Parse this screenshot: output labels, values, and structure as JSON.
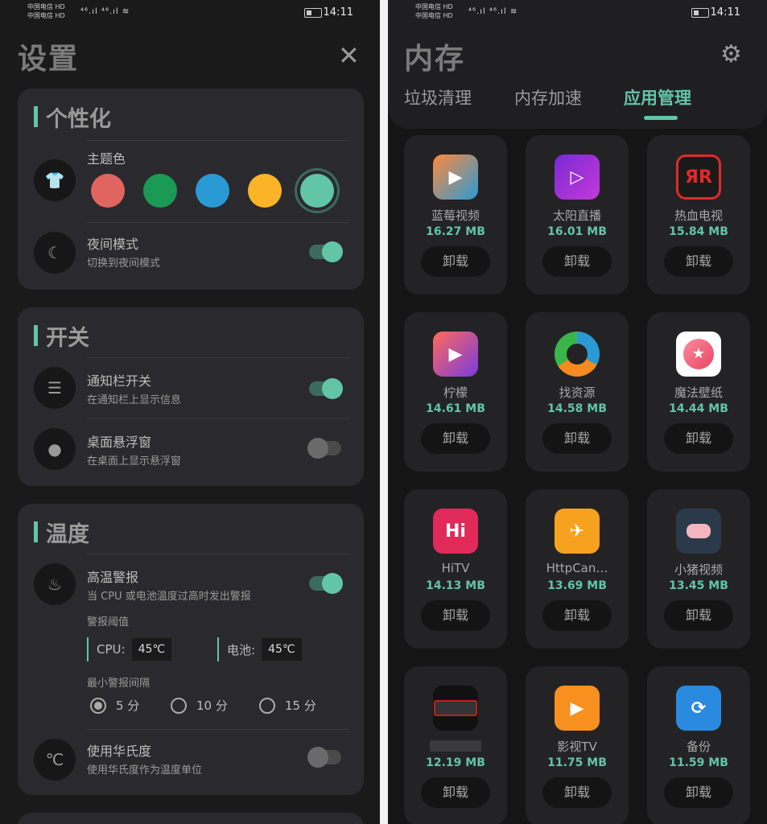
{
  "status": {
    "carrier1": "中国电信 HD",
    "carrier2": "中国电信 HD",
    "signal": "⁴⁶.ıl ⁴⁶.ıl ≋",
    "time": "14:11"
  },
  "settings": {
    "title": "设置",
    "close": "✕",
    "personalize": {
      "title": "个性化",
      "theme_label": "主题色",
      "colors": [
        "#e0645f",
        "#1a9a55",
        "#2a9ad4",
        "#fbb427",
        "#62c5a6"
      ],
      "selected_color": "#62c5a6",
      "night_title": "夜间模式",
      "night_sub": "切换到夜间模式",
      "night_on": true
    },
    "switches": {
      "title": "开关",
      "notify_title": "通知栏开关",
      "notify_sub": "在通知栏上显示信息",
      "notify_on": true,
      "float_title": "桌面悬浮窗",
      "float_sub": "在桌面上显示悬浮窗",
      "float_on": false
    },
    "temperature": {
      "title": "温度",
      "alert_title": "高温警报",
      "alert_sub": "当 CPU 或电池温度过高时发出警报",
      "alert_on": true,
      "threshold_label": "警报阈值",
      "cpu_label": "CPU:",
      "cpu_value": "45℃",
      "battery_label": "电池:",
      "battery_value": "45℃",
      "interval_label": "最小警报间隔",
      "intervals": [
        "5 分",
        "10 分",
        "15 分"
      ],
      "interval_selected": "5 分",
      "fahrenheit_title": "使用华氏度",
      "fahrenheit_sub": "使用华氏度作为温度单位",
      "fahrenheit_on": false
    }
  },
  "memory": {
    "title": "内存",
    "tabs": [
      "垃圾清理",
      "内存加速",
      "应用管理"
    ],
    "active_tab": "应用管理",
    "uninstall_label": "卸载",
    "apps": [
      {
        "name": "蓝莓视频",
        "size": "16.27 MB",
        "icon": "play-icon"
      },
      {
        "name": "太阳直播",
        "size": "16.01 MB",
        "icon": "play-icon"
      },
      {
        "name": "热血电视",
        "size": "15.84 MB",
        "icon": "r-icon"
      },
      {
        "name": "柠檬",
        "size": "14.61 MB",
        "icon": "play-icon"
      },
      {
        "name": "找资源",
        "size": "14.58 MB",
        "icon": "ring-icon"
      },
      {
        "name": "魔法壁纸",
        "size": "14.44 MB",
        "icon": "star-icon"
      },
      {
        "name": "HiTV",
        "size": "14.13 MB",
        "icon": "hi-icon"
      },
      {
        "name": "HttpCan…",
        "size": "13.69 MB",
        "icon": "bird-icon"
      },
      {
        "name": "小猪视频",
        "size": "13.45 MB",
        "icon": "pig-icon"
      },
      {
        "name": "",
        "size": "12.19 MB",
        "icon": "redacted-icon"
      },
      {
        "name": "影视TV",
        "size": "11.75 MB",
        "icon": "film-icon"
      },
      {
        "name": "备份",
        "size": "11.59 MB",
        "icon": "backup-icon"
      }
    ]
  }
}
